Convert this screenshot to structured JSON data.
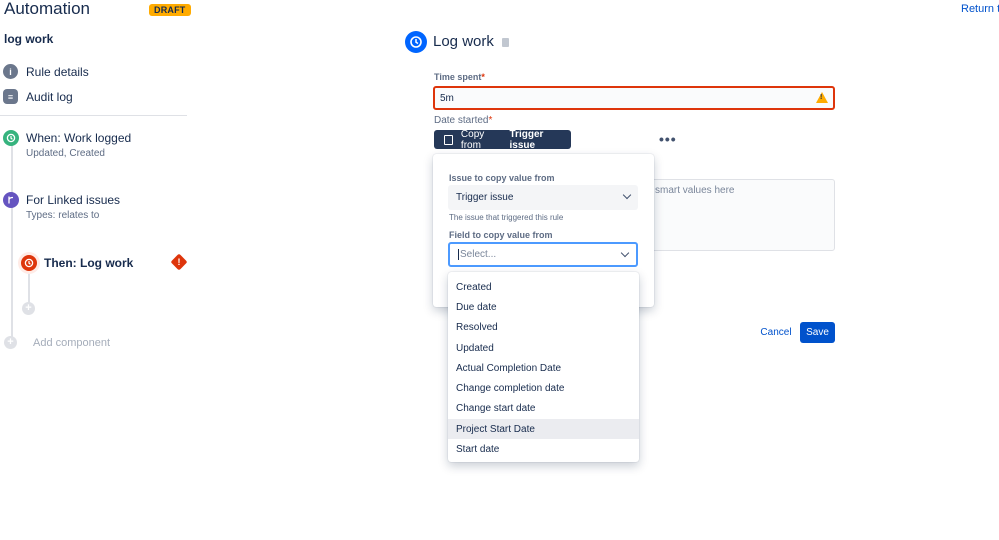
{
  "header": {
    "app_title": "Automation",
    "draft_badge": "DRAFT",
    "return_link": "Return to"
  },
  "rule": {
    "name": "log work"
  },
  "sidebar": {
    "nav": [
      {
        "label": "Rule details",
        "icon": "info-icon"
      },
      {
        "label": "Audit log",
        "icon": "list-icon"
      }
    ],
    "trigger": {
      "title": "When: Work logged",
      "subtitle": "Updated, Created",
      "color": "#36b37e"
    },
    "branch": {
      "title": "For Linked issues",
      "subtitle": "Types: relates to",
      "color": "#6554c0"
    },
    "action": {
      "title": "Then: Log work",
      "error_icon": "error-icon",
      "color": "#de350b"
    },
    "add_component": "Add component"
  },
  "main": {
    "title": "Log work",
    "time_spent": {
      "label": "Time spent",
      "value": "5m"
    },
    "date_started": {
      "label": "Date started"
    },
    "copy_button": {
      "prefix": "Copy from",
      "bold": "Trigger issue"
    },
    "more_icon": "•••",
    "textarea_placeholder": "smart values here",
    "cancel": "Cancel",
    "save": "Save"
  },
  "popup": {
    "issue_label": "Issue to copy value from",
    "issue_value": "Trigger issue",
    "issue_help": "The issue that triggered this rule",
    "field_label": "Field to copy value from",
    "field_placeholder": "Select..."
  },
  "menu": {
    "items": [
      "Created",
      "Due date",
      "Resolved",
      "Updated",
      "Actual Completion Date",
      "Change completion date",
      "Change start date",
      "Project Start Date",
      "Start date"
    ],
    "hovered": "Project Start Date"
  },
  "colors": {
    "accent": "#0052cc",
    "error": "#de350b",
    "warning": "#ffab00",
    "dark_button": "#253858"
  }
}
